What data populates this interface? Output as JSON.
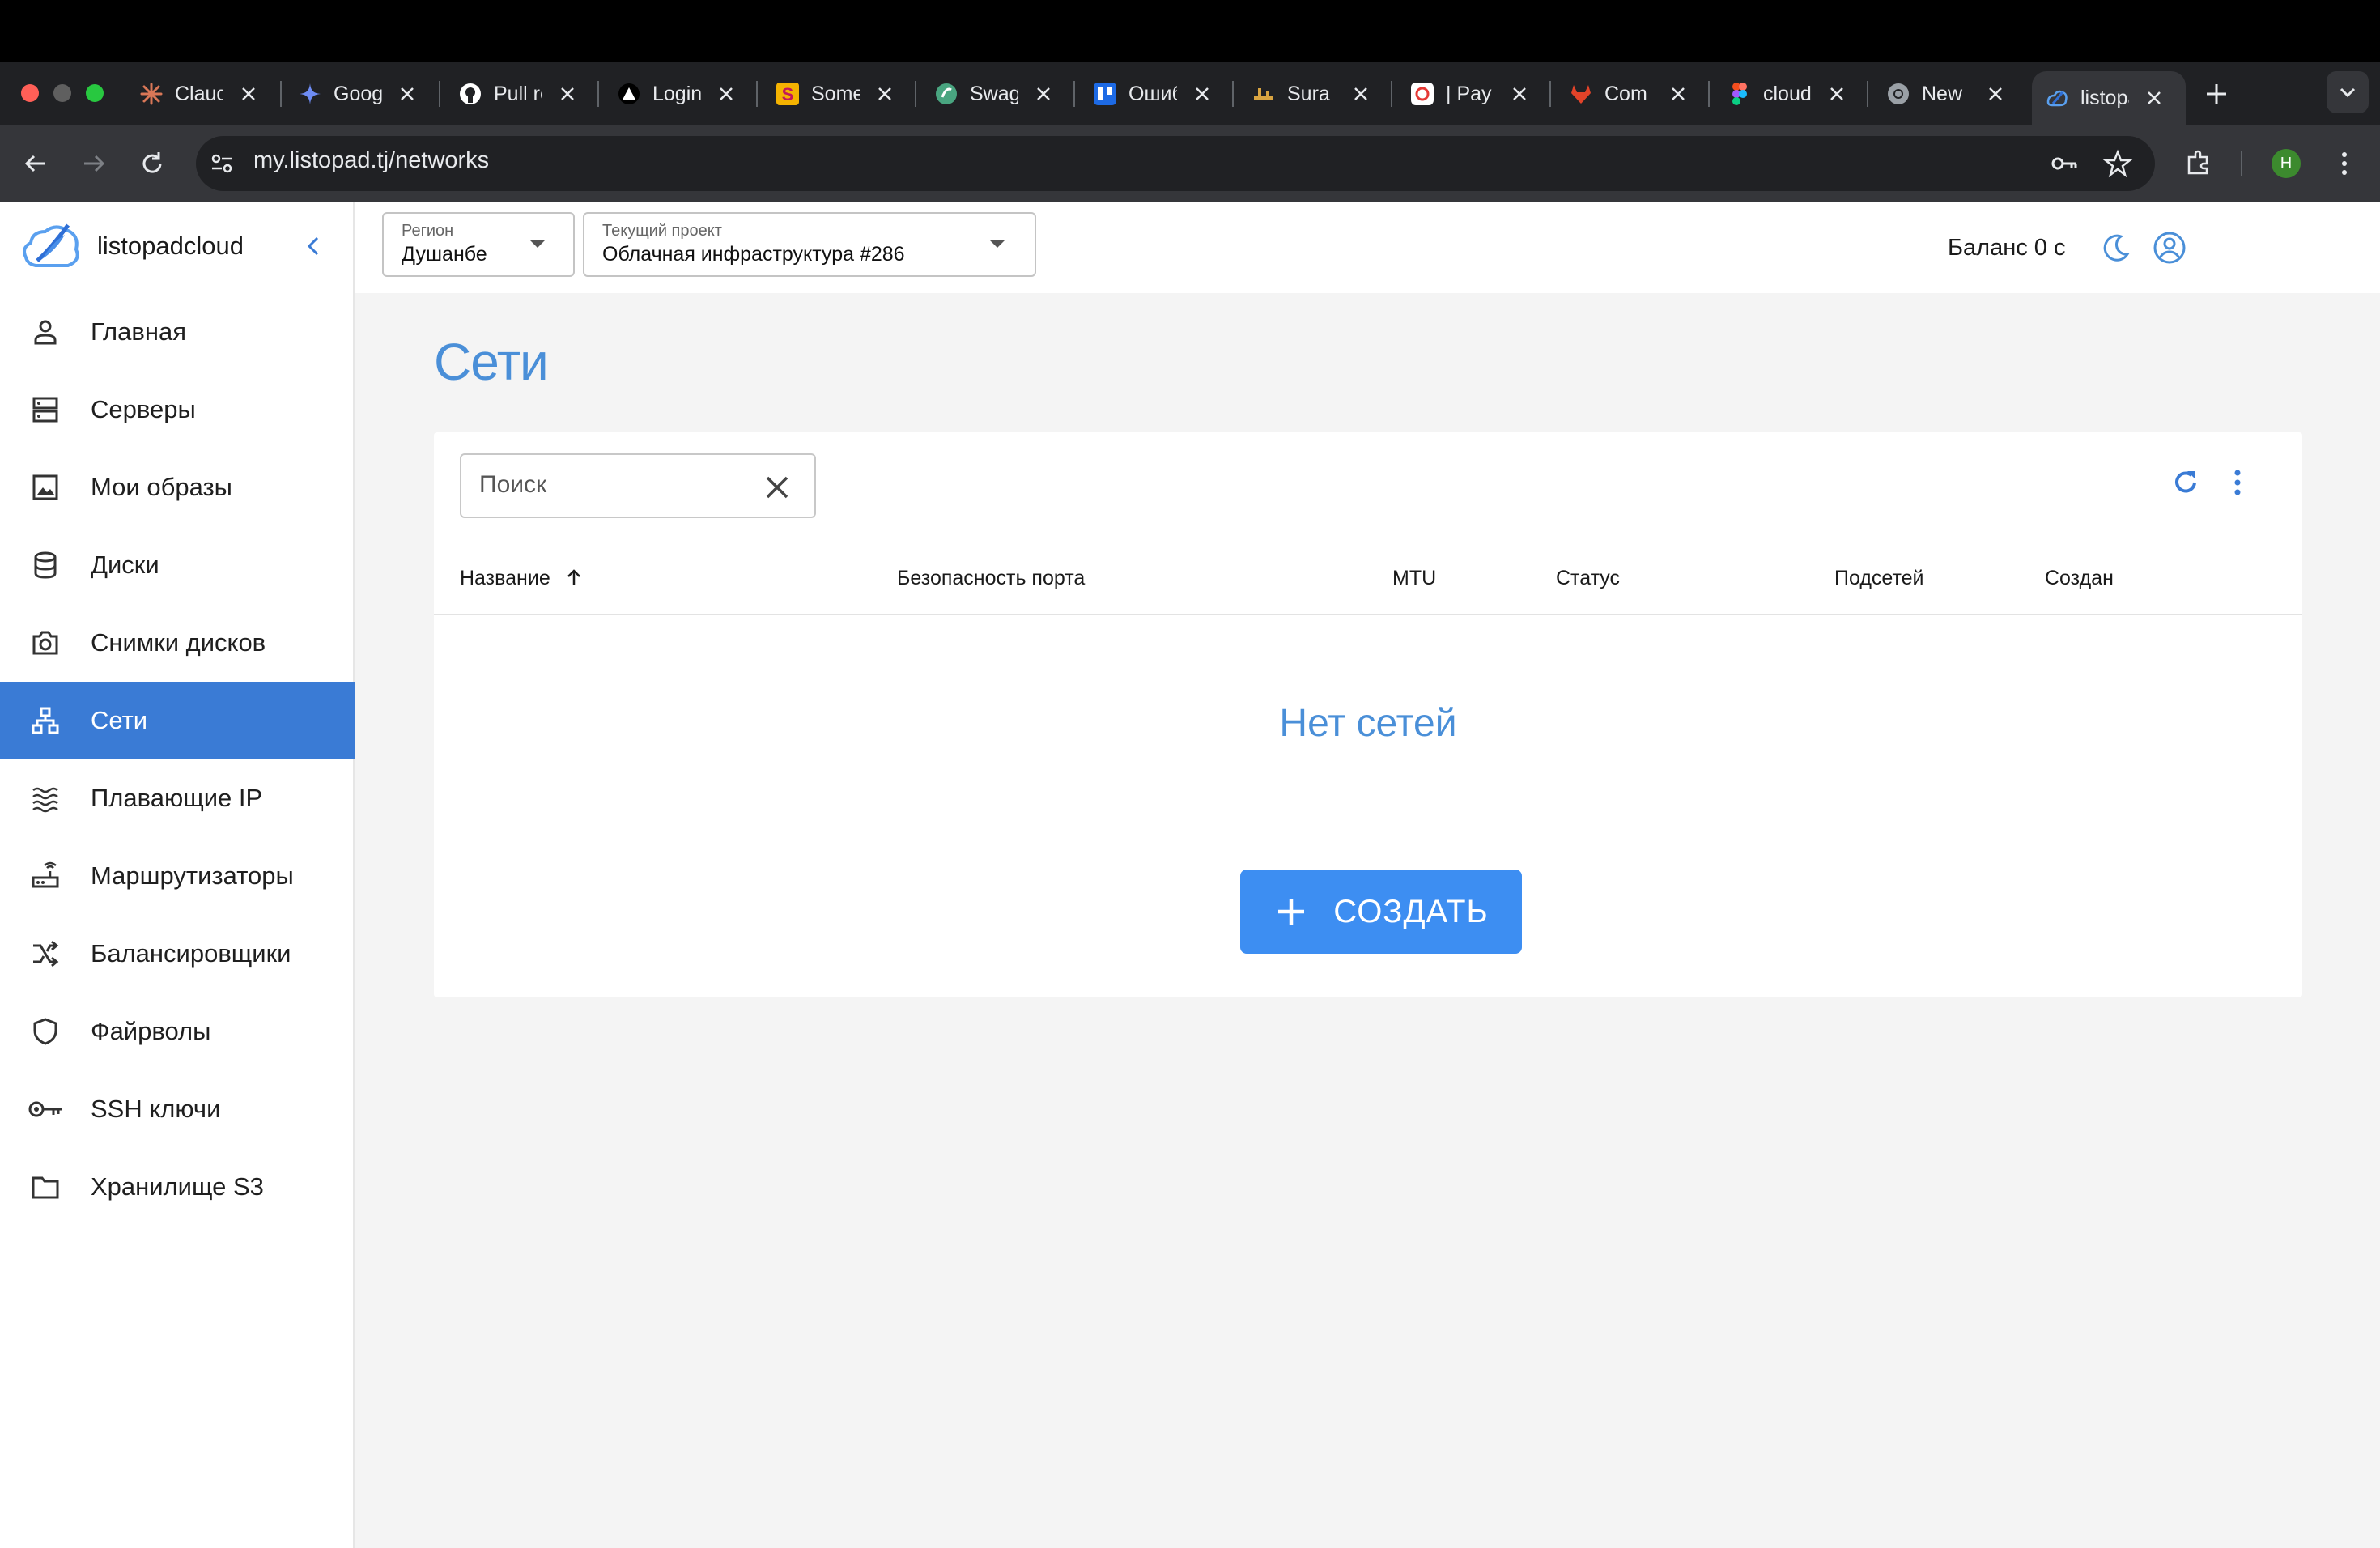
{
  "browser": {
    "tabs": [
      {
        "label": "Claude",
        "icon": "claude-icon"
      },
      {
        "label": "Google",
        "icon": "gemini-icon"
      },
      {
        "label": "Pull requests",
        "icon": "github-icon"
      },
      {
        "label": "Login",
        "icon": "triangle-icon"
      },
      {
        "label": "Some",
        "icon": "s-logo-icon"
      },
      {
        "label": "Swagger",
        "icon": "swagger-icon"
      },
      {
        "label": "Ошибки",
        "icon": "trello-icon"
      },
      {
        "label": "Sura",
        "icon": "sura-icon"
      },
      {
        "label": "| Pay",
        "icon": "pay-icon"
      },
      {
        "label": "Com",
        "icon": "gitlab-icon"
      },
      {
        "label": "cloud",
        "icon": "figma-icon"
      },
      {
        "label": "New",
        "icon": "chrome-icon"
      },
      {
        "label": "listopad",
        "icon": "listopad-icon"
      }
    ],
    "url": "my.listopad.tj/networks",
    "profile_initial": "H"
  },
  "sidebar": {
    "brand": "listopadcloud",
    "items": [
      {
        "label": "Главная",
        "icon": "person-icon"
      },
      {
        "label": "Серверы",
        "icon": "servers-icon"
      },
      {
        "label": "Мои образы",
        "icon": "image-icon"
      },
      {
        "label": "Диски",
        "icon": "database-icon"
      },
      {
        "label": "Снимки дисков",
        "icon": "camera-icon"
      },
      {
        "label": "Сети",
        "icon": "network-icon"
      },
      {
        "label": "Плавающие IP",
        "icon": "waves-icon"
      },
      {
        "label": "Маршрутизаторы",
        "icon": "router-icon"
      },
      {
        "label": "Балансировщики",
        "icon": "balancer-icon"
      },
      {
        "label": "Файрволы",
        "icon": "shield-icon"
      },
      {
        "label": "SSH ключи",
        "icon": "key-icon"
      },
      {
        "label": "Хранилище S3",
        "icon": "folder-icon"
      }
    ]
  },
  "header": {
    "region_label": "Регион",
    "region_value": "Душанбе",
    "project_label": "Текущий проект",
    "project_value": "Облачная инфраструктура #286",
    "balance": "Баланс 0 с"
  },
  "main": {
    "title": "Сети",
    "search_placeholder": "Поиск",
    "columns": [
      "Название",
      "Безопасность порта",
      "MTU",
      "Статус",
      "Подсетей",
      "Создан"
    ],
    "empty_text": "Нет сетей",
    "create_label": "СОЗДАТЬ"
  },
  "colors": {
    "accent": "#3a7bd5",
    "title": "#4a8fd8",
    "button": "#3d8ef2"
  }
}
